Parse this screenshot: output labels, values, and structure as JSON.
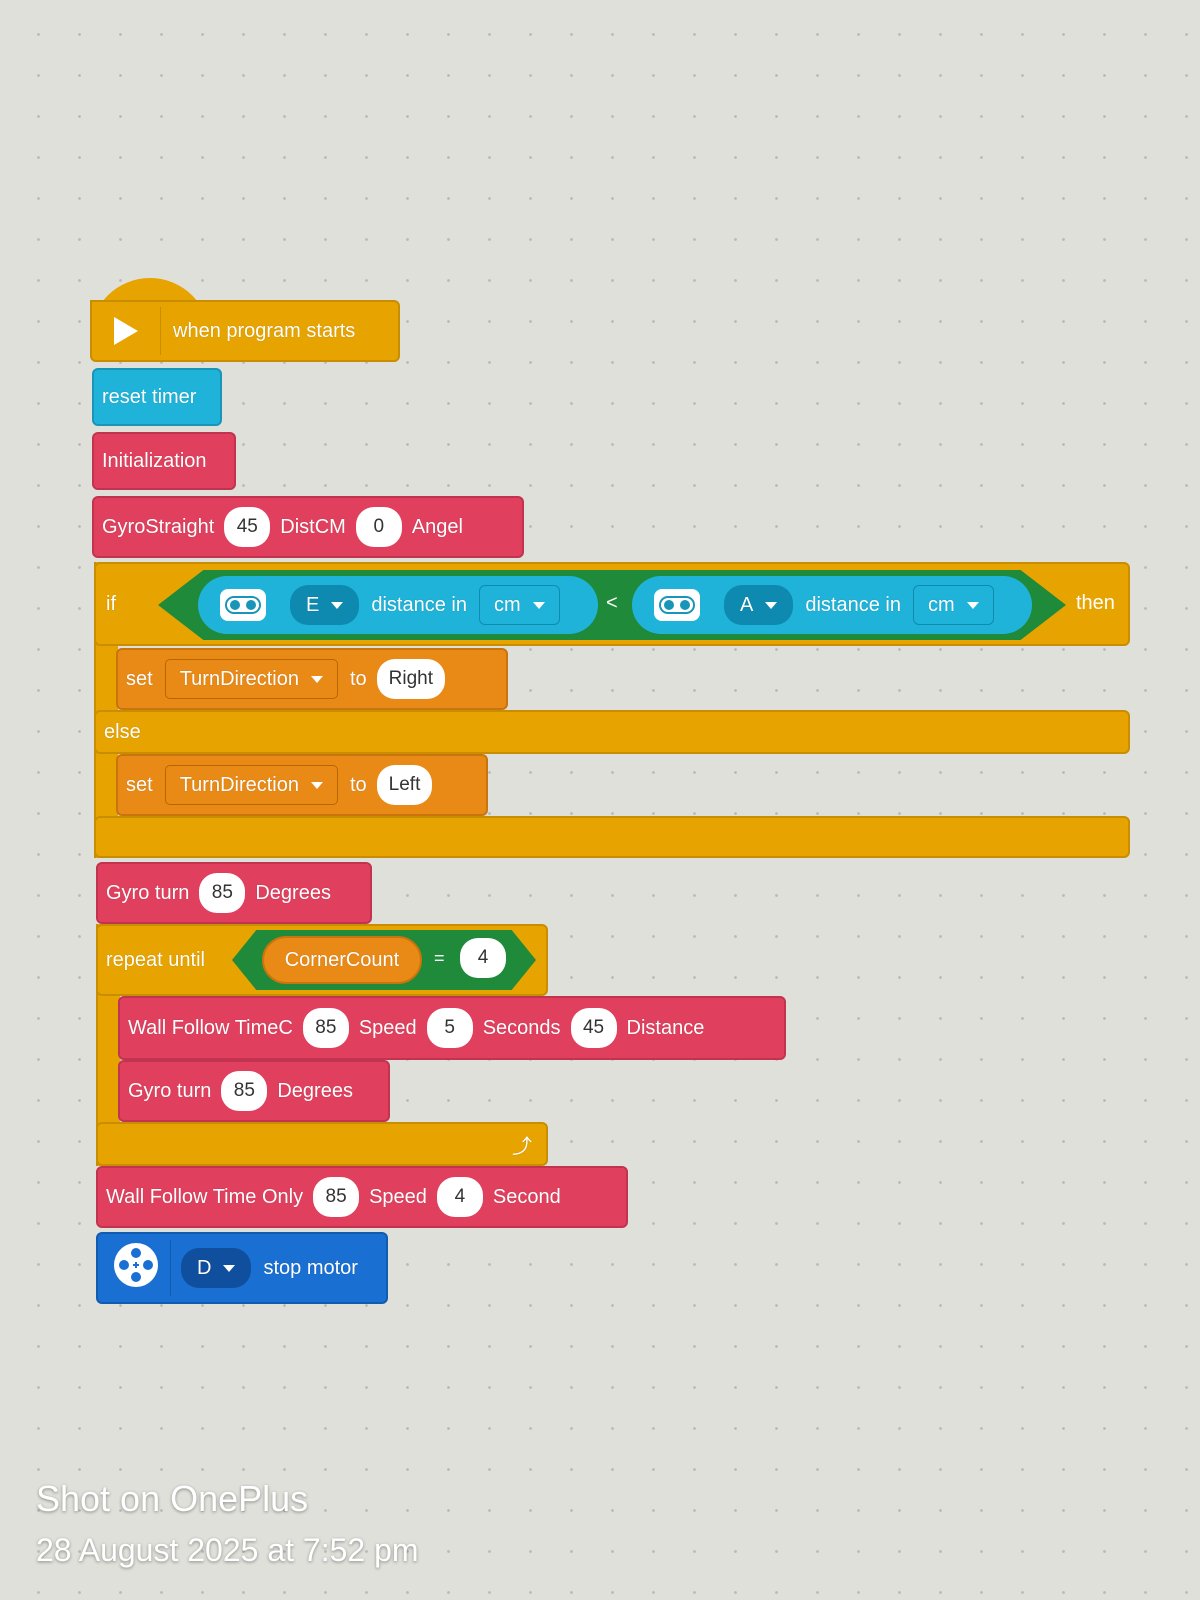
{
  "hat": {
    "label": "when program starts"
  },
  "reset": {
    "label": "reset timer"
  },
  "init": {
    "label": "Initialization"
  },
  "gyro_straight": {
    "label": "GyroStraight",
    "speed": "45",
    "dist_label": "DistCM",
    "dist": "0",
    "angle_label": "Angel"
  },
  "if_block": {
    "if_label": "if",
    "then_label": "then",
    "else_label": "else",
    "left": {
      "port": "E",
      "label": "distance in",
      "unit": "cm"
    },
    "operator": "<",
    "right": {
      "port": "A",
      "label": "distance in",
      "unit": "cm"
    },
    "branch_true": {
      "set_label": "set",
      "variable": "TurnDirection",
      "to_label": "to",
      "value": "Right"
    },
    "branch_false": {
      "set_label": "set",
      "variable": "TurnDirection",
      "to_label": "to",
      "value": "Left"
    }
  },
  "gyro_turn_1": {
    "label": "Gyro turn",
    "value": "85",
    "unit": "Degrees"
  },
  "repeat": {
    "label": "repeat until",
    "variable": "CornerCount",
    "operator": "=",
    "value": "4",
    "wall_follow": {
      "label": "Wall Follow TimeC",
      "speed": "85",
      "speed_label": "Speed",
      "seconds": "5",
      "seconds_label": "Seconds",
      "distance": "45",
      "distance_label": "Distance"
    },
    "gyro_turn": {
      "label": "Gyro turn",
      "value": "85",
      "unit": "Degrees"
    }
  },
  "wall_follow_time": {
    "label": "Wall Follow Time Only",
    "speed": "85",
    "speed_label": "Speed",
    "seconds": "4",
    "seconds_label": "Second"
  },
  "stop_motor": {
    "port": "D",
    "label": "stop motor"
  },
  "watermark": {
    "line1": "Shot on OnePlus",
    "line2": "28 August 2025 at 7:52 pm"
  },
  "colors": {
    "event": "#e7a400",
    "sensor": "#1fb3da",
    "myblocks": "#e0405e",
    "variables": "#e98a17",
    "operators": "#1e8a3a",
    "motors": "#1a6fd2"
  }
}
